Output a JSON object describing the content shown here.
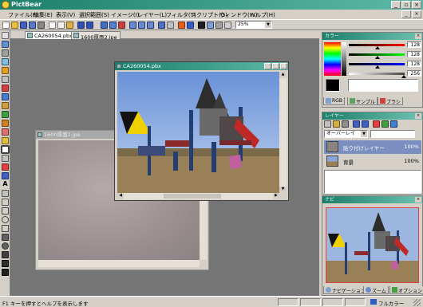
{
  "app": {
    "title": "PictBear"
  },
  "menu": [
    "ファイル(F)",
    "編集(E)",
    "表示(V)",
    "選択範囲(S)",
    "イメージ(I)",
    "レイヤー(L)",
    "フィルタ(T)",
    "スクリプト(G)",
    "ウィンドウ(W)",
    "ヘルプ(H)"
  ],
  "toolbar": {
    "zoom": "25%"
  },
  "tabs": [
    "CA260054.pbx",
    "1600厚面2.jpe"
  ],
  "windows": {
    "front": {
      "title": "CA260054.pbx"
    },
    "back": {
      "title": "1600厚面2.jpe"
    }
  },
  "panels": {
    "palette": {
      "title": "カラー",
      "values": {
        "r": "128",
        "g": "128",
        "b": "128",
        "a": "256"
      },
      "tabs": [
        "RGB",
        "サンプル",
        "ブラシ"
      ]
    },
    "layers": {
      "title": "レイヤー",
      "blend_mode": "オーバーレイ",
      "rows": [
        {
          "name": "貼り付けレイヤー",
          "opacity": "100%"
        },
        {
          "name": "背景",
          "opacity": "100%"
        }
      ]
    },
    "navigator": {
      "title": "ナビ",
      "tabs": [
        "ナビゲーション",
        "ズーム",
        "オプション"
      ]
    }
  },
  "status": {
    "text": "F1 キーを押すとヘルプを表示します",
    "right": "フルカラー"
  },
  "colors": {
    "accent": "#1c7f6a"
  }
}
